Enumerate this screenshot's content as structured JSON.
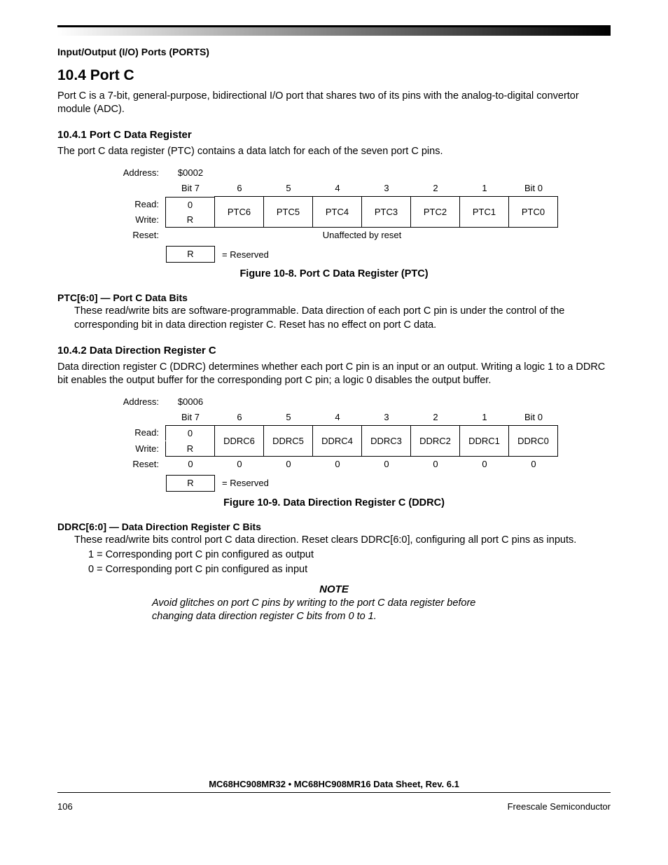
{
  "header": "Input/Output (I/O) Ports (PORTS)",
  "h2": "10.4  Port C",
  "intro": "Port C is a 7-bit, general-purpose, bidirectional I/O port that shares two of its pins with the analog-to-digital convertor module (ADC).",
  "sec1": {
    "title": "10.4.1  Port C Data Register",
    "body": "The port C data register (PTC) contains a data latch for each of the seven port C pins.",
    "addressLabel": "Address:",
    "address": "$0002",
    "bitHeaders": [
      "Bit 7",
      "6",
      "5",
      "4",
      "3",
      "2",
      "1",
      "Bit 0"
    ],
    "readLabel": "Read:",
    "writeLabel": "Write:",
    "resetLabel": "Reset:",
    "bit7read": "0",
    "bit7write": "R",
    "bits": [
      "PTC6",
      "PTC5",
      "PTC4",
      "PTC3",
      "PTC2",
      "PTC1",
      "PTC0"
    ],
    "reset": "Unaffected by reset",
    "reservedSym": "R",
    "reservedText": "= Reserved",
    "cap": "Figure 10-8. Port C Data Register (PTC)",
    "field": "PTC[6:0] — Port C Data Bits",
    "fieldDesc": "These read/write bits are software-programmable. Data direction of each port C pin is under the control of the corresponding bit in data direction register C. Reset has no effect on port C data."
  },
  "sec2": {
    "title": "10.4.2  Data Direction Register C",
    "body": "Data direction register C (DDRC) determines whether each port C pin is an input or an output. Writing a logic 1 to a DDRC bit enables the output buffer for the corresponding port C pin; a logic 0 disables the output buffer.",
    "addressLabel": "Address:",
    "address": "$0006",
    "bitHeaders": [
      "Bit 7",
      "6",
      "5",
      "4",
      "3",
      "2",
      "1",
      "Bit 0"
    ],
    "readLabel": "Read:",
    "writeLabel": "Write:",
    "resetLabel": "Reset:",
    "bit7read": "0",
    "bit7write": "R",
    "bits": [
      "DDRC6",
      "DDRC5",
      "DDRC4",
      "DDRC3",
      "DDRC2",
      "DDRC1",
      "DDRC0"
    ],
    "resetValues": [
      "0",
      "0",
      "0",
      "0",
      "0",
      "0",
      "0",
      "0"
    ],
    "reservedSym": "R",
    "reservedText": "= Reserved",
    "cap": "Figure 10-9. Data Direction Register C (DDRC)",
    "field": "DDRC[6:0] — Data Direction Register C Bits",
    "fieldDesc": "These read/write bits control port C data direction. Reset clears DDRC[6:0], configuring all port C pins as inputs.",
    "opt1": "1 = Corresponding port C pin configured as output",
    "opt0": "0 = Corresponding port C pin configured as input"
  },
  "noteTitle": "NOTE",
  "noteBody": "Avoid glitches on port C pins by writing to the port C data register before changing data direction register C bits from 0 to 1.",
  "footer": {
    "doc": "MC68HC908MR32 • MC68HC908MR16 Data Sheet, Rev. 6.1",
    "page": "106",
    "vendor": "Freescale Semiconductor"
  }
}
